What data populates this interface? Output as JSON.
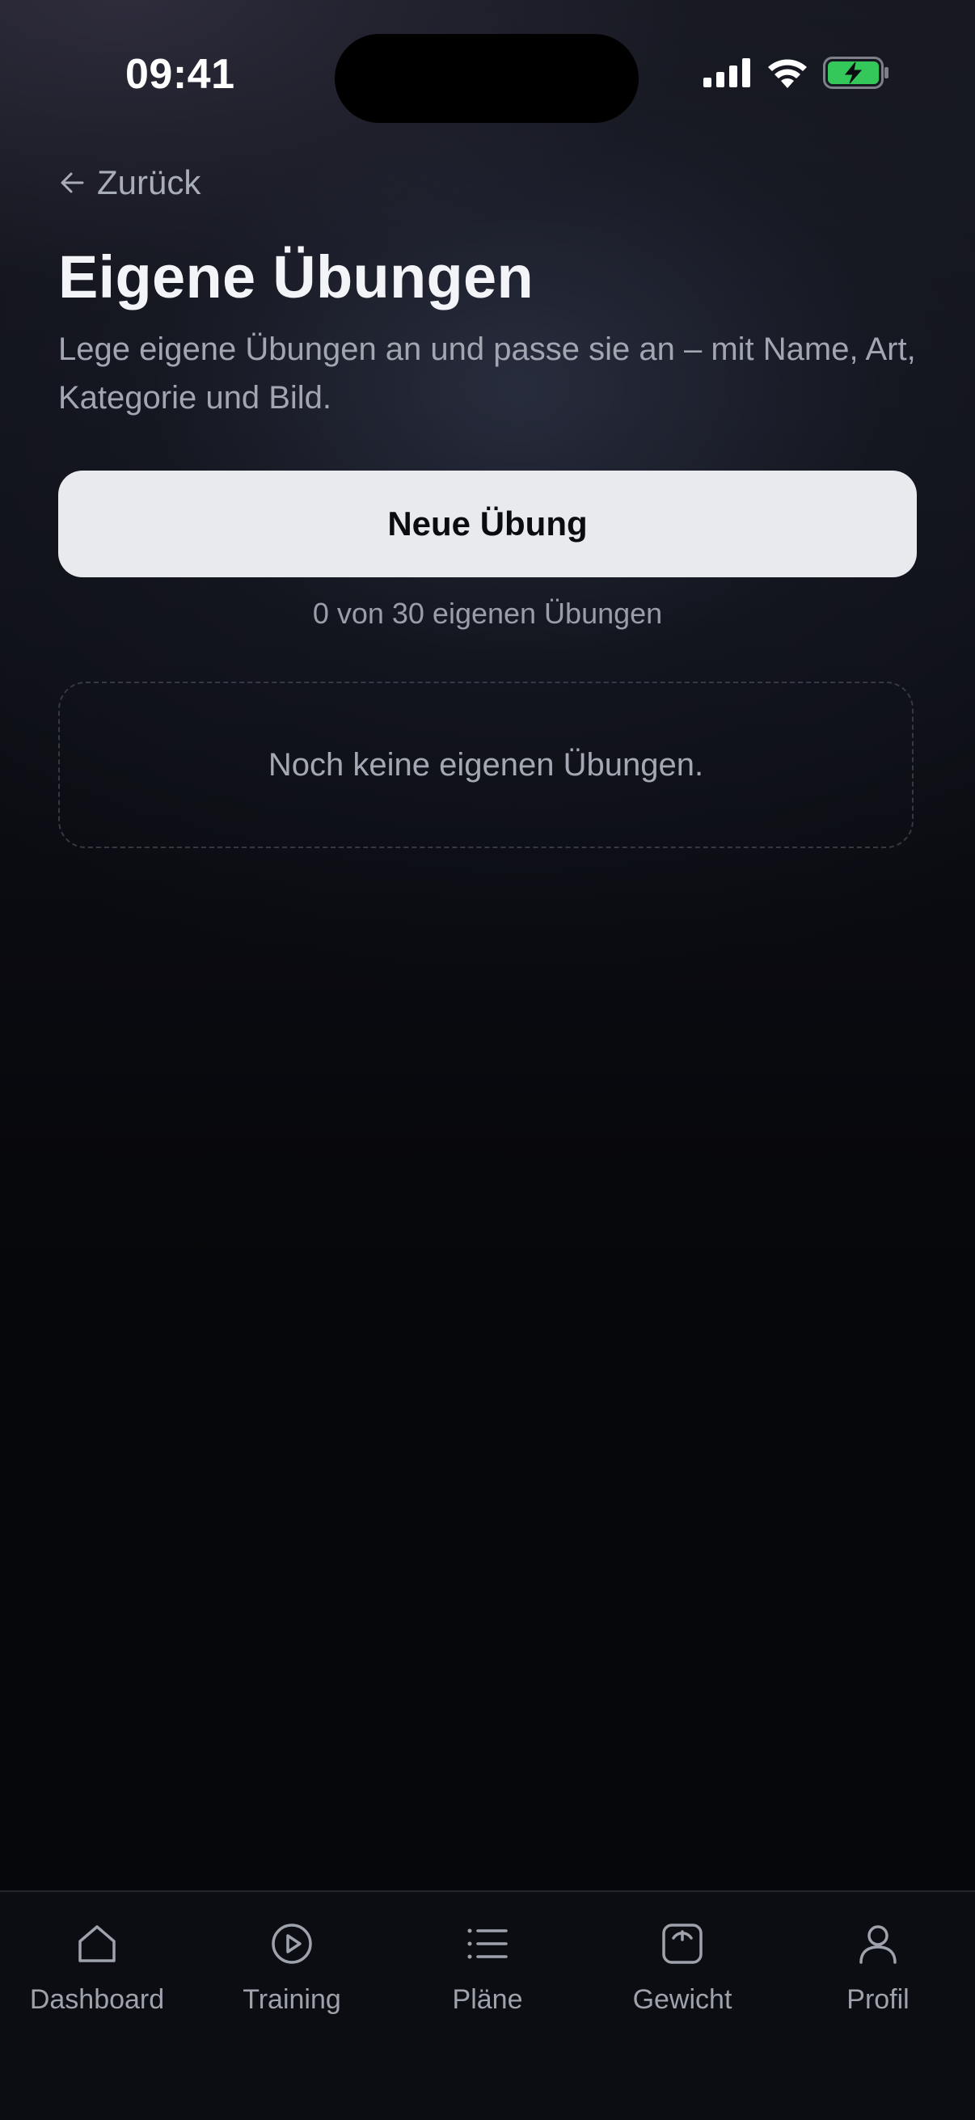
{
  "status_bar": {
    "time": "09:41",
    "icons": [
      "cellular-signal-icon",
      "wifi-icon",
      "battery-charging-icon"
    ],
    "battery_color": "#34c759"
  },
  "header": {
    "back_label": "Zurück",
    "title": "Eigene Übungen",
    "subtitle": "Lege eigene Übungen an und passe sie an – mit Name, Art, Kategorie und Bild."
  },
  "actions": {
    "new_exercise_label": "Neue Übung"
  },
  "exercise_count": {
    "text": "0 von 30 eigenen Übungen",
    "current": 0,
    "max": 30
  },
  "empty_state": {
    "message": "Noch keine eigenen Übungen."
  },
  "tab_bar": {
    "items": [
      {
        "label": "Dashboard",
        "icon": "home-icon"
      },
      {
        "label": "Training",
        "icon": "play-circle-icon"
      },
      {
        "label": "Pläne",
        "icon": "list-icon"
      },
      {
        "label": "Gewicht",
        "icon": "scale-icon"
      },
      {
        "label": "Profil",
        "icon": "user-icon"
      }
    ]
  },
  "colors": {
    "background": "#06070a",
    "button_bg": "#e9eaee",
    "muted_text": "#a2a6b1"
  }
}
